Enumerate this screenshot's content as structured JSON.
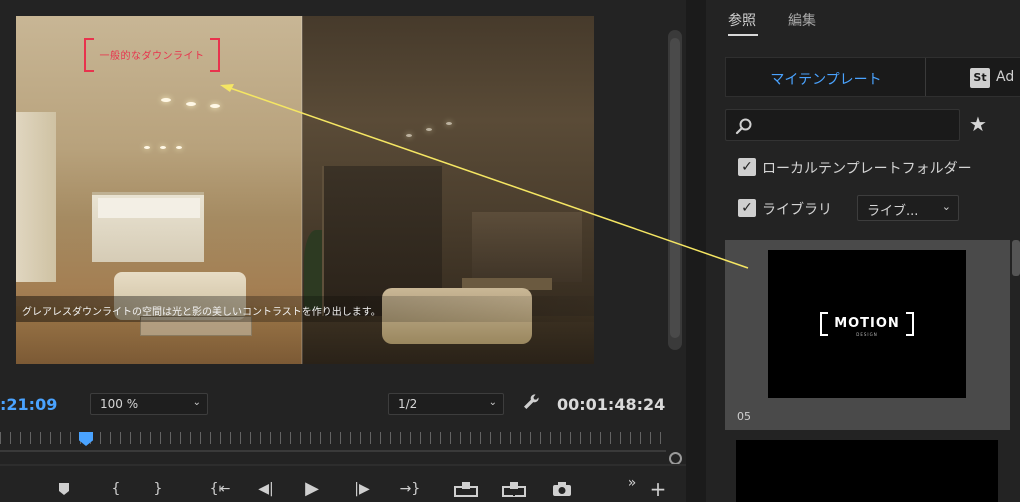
{
  "monitor": {
    "overlay_label": "一般的なダウンライト",
    "caption": "グレアレスダウンライトの空間は光と影の美しいコントラストを作り出します。",
    "timecode_in": ":21:09",
    "zoom": "100 %",
    "resolution": "1/2",
    "timecode_duration": "00:01:48:24",
    "playhead_progress": 0.12
  },
  "transport": {
    "add_marker": "⬇",
    "mark_in": "{",
    "mark_out": "}",
    "go_to_in": "{⇤",
    "step_back": "◀|",
    "play": "▶",
    "step_forward": "|▶",
    "go_to_out": "→}",
    "lift": "⏏",
    "extract": "⛘",
    "export_frame": "📷",
    "more": "»",
    "add": "+"
  },
  "panel": {
    "tabs": [
      "参照",
      "編集"
    ],
    "active_tab": "参照",
    "segment_mine": "マイテンプレート",
    "segment_stock_icon": "St",
    "segment_stock": "Ad",
    "search_value": "",
    "checkbox_local": "ローカルテンプレートフォルダー",
    "checkbox_library": "ライブラリ",
    "library_dropdown": "ライブ...",
    "template_logo": "MOTION",
    "template_logo_sub": "DESIGN",
    "template_name": "05"
  },
  "colors": {
    "accent_blue": "#4aa3ff",
    "label_red": "#e8334d",
    "arrow_yellow": "#f5e663"
  }
}
